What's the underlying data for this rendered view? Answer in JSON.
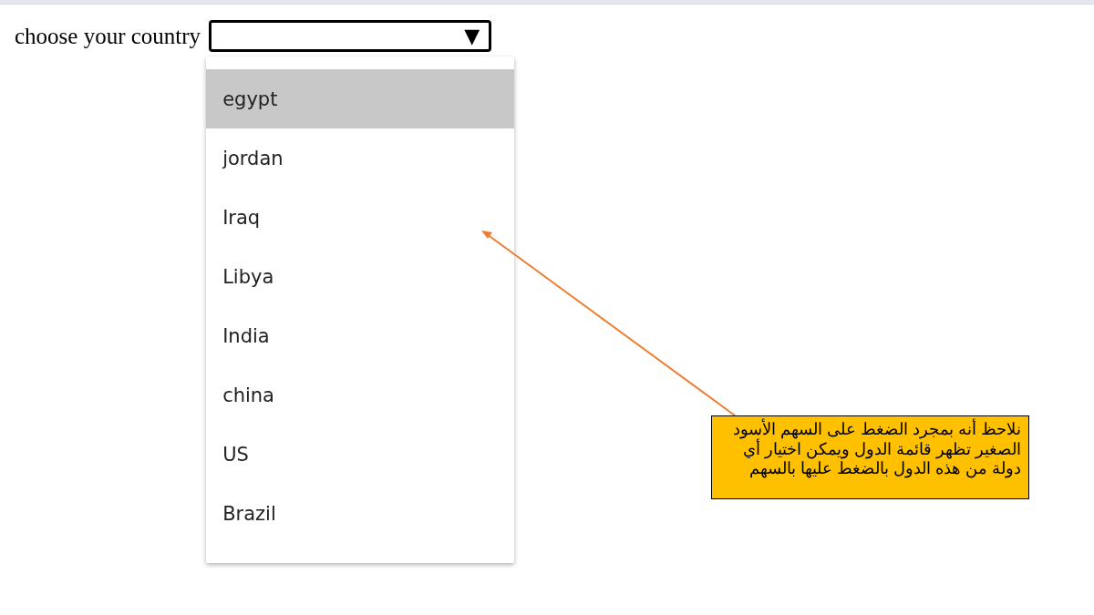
{
  "label": "choose your country",
  "select": {
    "arrow": "▼"
  },
  "options": [
    {
      "label": "egypt",
      "selected": true
    },
    {
      "label": "jordan",
      "selected": false
    },
    {
      "label": "Iraq",
      "selected": false
    },
    {
      "label": "Libya",
      "selected": false
    },
    {
      "label": "India",
      "selected": false
    },
    {
      "label": "china",
      "selected": false
    },
    {
      "label": "US",
      "selected": false
    },
    {
      "label": "Brazil",
      "selected": false
    }
  ],
  "callout": {
    "text": "نلاحظ أنه بمجرد الضغط على السهم الأسود الصغير تظهر قائمة الدول ويمكن اختيار أي دولة من هذه الدول بالضغط عليها بالسهم"
  }
}
